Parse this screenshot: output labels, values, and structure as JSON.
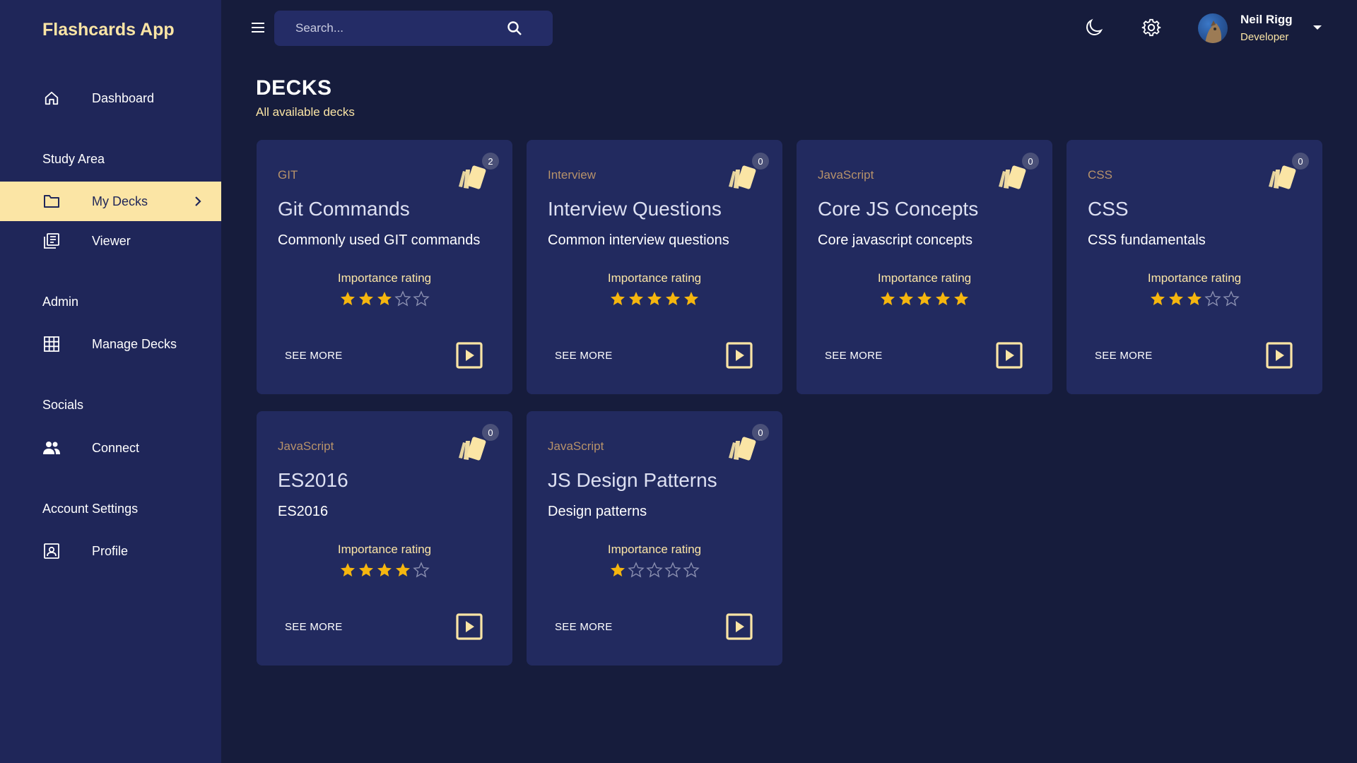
{
  "app": {
    "title": "Flashcards App"
  },
  "sidebar": {
    "dashboard": "Dashboard",
    "study_area": "Study Area",
    "my_decks": "My Decks",
    "viewer": "Viewer",
    "admin": "Admin",
    "manage_decks": "Manage Decks",
    "socials": "Socials",
    "connect": "Connect",
    "account_settings": "Account Settings",
    "profile": "Profile"
  },
  "topbar": {
    "search_placeholder": "Search...",
    "user": {
      "name": "Neil Rigg",
      "role": "Developer"
    }
  },
  "header": {
    "title": "DECKS",
    "subtitle": "All available decks"
  },
  "labels": {
    "importance": "Importance rating",
    "see_more": "SEE MORE"
  },
  "colors": {
    "accent": "#fbe5a5",
    "star": "#f5b60f",
    "sidebar": "#1f2659",
    "card": "#222a5f",
    "background": "#161c3c"
  },
  "decks": [
    {
      "category": "GIT",
      "title": "Git Commands",
      "description": "Commonly used GIT commands",
      "count": "2",
      "rating": 3
    },
    {
      "category": "Interview",
      "title": "Interview Questions",
      "description": "Common interview questions",
      "count": "0",
      "rating": 5
    },
    {
      "category": "JavaScript",
      "title": "Core JS Concepts",
      "description": "Core javascript concepts",
      "count": "0",
      "rating": 5
    },
    {
      "category": "CSS",
      "title": "CSS",
      "description": "CSS fundamentals",
      "count": "0",
      "rating": 3
    },
    {
      "category": "JavaScript",
      "title": "ES2016",
      "description": "ES2016",
      "count": "0",
      "rating": 4
    },
    {
      "category": "JavaScript",
      "title": "JS Design Patterns",
      "description": "Design patterns",
      "count": "0",
      "rating": 1
    }
  ]
}
